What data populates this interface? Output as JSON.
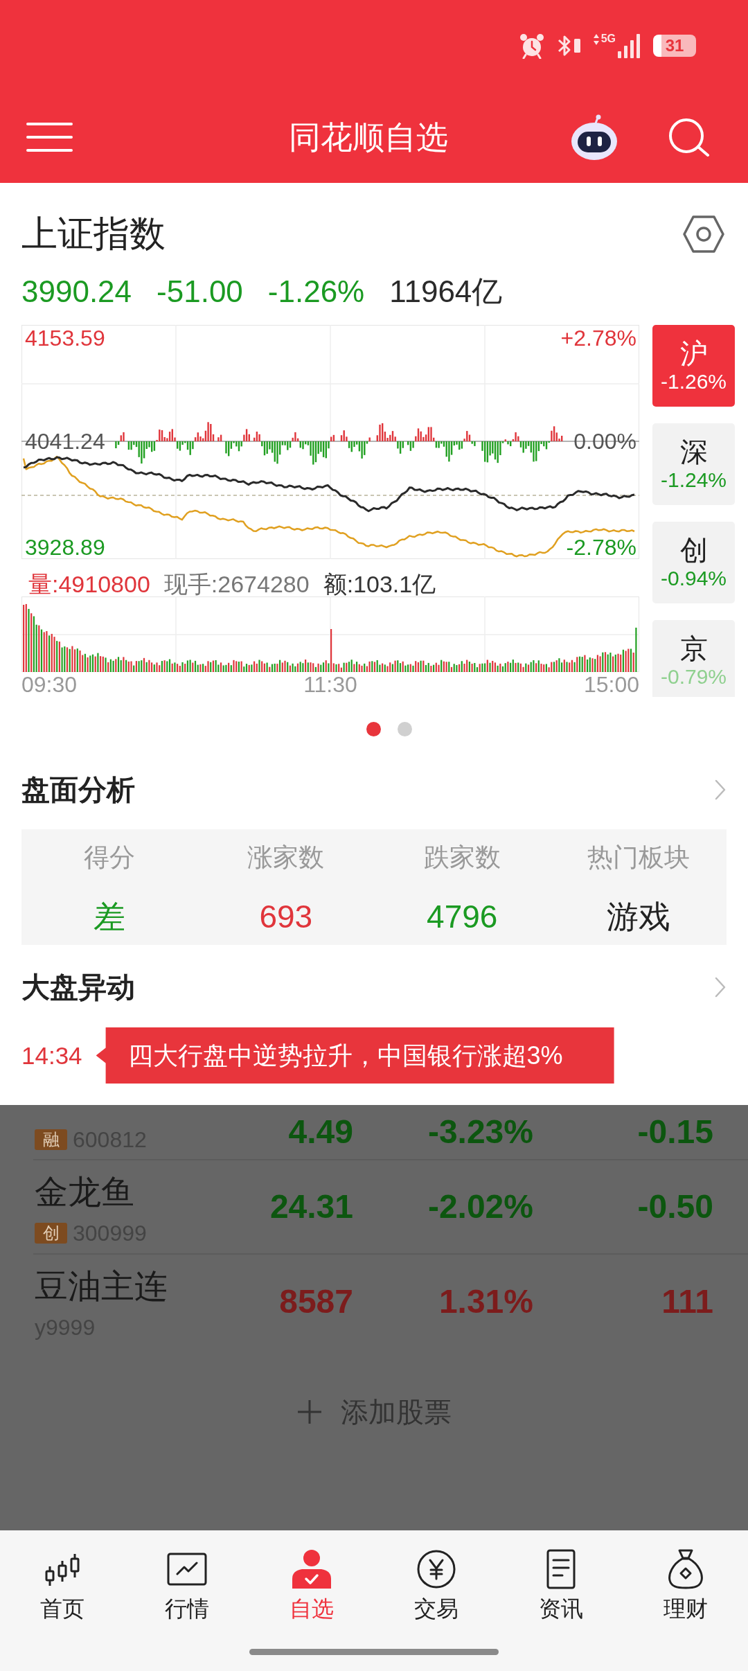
{
  "status_bar": {
    "network": "5G",
    "battery": "31"
  },
  "header": {
    "title": "同花顺自选"
  },
  "index": {
    "name": "上证指数",
    "price": "3990.24",
    "change": "-51.00",
    "percent": "-1.26%",
    "color": "#1b9a22",
    "turnover": "11964亿"
  },
  "chart": {
    "high": "4153.59",
    "high_percent": "+2.78%",
    "base": "4041.24",
    "base_percent": "0.00%",
    "low": "3928.89",
    "low_percent": "-2.78%",
    "volume": "量:4910800",
    "current_hand": "现手:2674280",
    "amount": "额:103.1亿",
    "times": [
      "09:30",
      "11:30",
      "15:00"
    ]
  },
  "market_tabs": [
    {
      "label": "沪",
      "percent": "-1.26%",
      "color": "#ffffff",
      "selected": true
    },
    {
      "label": "深",
      "percent": "-1.24%",
      "color": "#1b9a22",
      "selected": false
    },
    {
      "label": "创",
      "percent": "-0.94%",
      "color": "#1b9a22",
      "selected": false
    },
    {
      "label": "京",
      "percent": "-0.79%",
      "color": "#8fd08f",
      "selected": false
    }
  ],
  "pager": [
    {
      "selected": true
    },
    {
      "selected": false
    }
  ],
  "market_analysis": {
    "title": "盘面分析",
    "stats": [
      {
        "label": "得分",
        "value": "差",
        "color": "#1b9a22"
      },
      {
        "label": "涨家数",
        "value": "693",
        "color": "#e0353b"
      },
      {
        "label": "跌家数",
        "value": "4796",
        "color": "#1b9a22"
      },
      {
        "label": "热门板块",
        "value": "游戏",
        "color": "#222222"
      }
    ]
  },
  "market_moves": {
    "title": "大盘异动",
    "events": [
      {
        "time": "14:34",
        "text": "四大行盘中逆势拉升，中国银行涨超3%"
      }
    ]
  },
  "watchlist": [
    {
      "badge": "融",
      "code": "600812",
      "price": "4.49",
      "percent": "-3.23%",
      "change": "-0.15",
      "color": "#0c560f"
    },
    {
      "name": "金龙鱼",
      "badge": "创",
      "code": "300999",
      "price": "24.31",
      "percent": "-2.02%",
      "change": "-0.50",
      "color": "#0c560f"
    },
    {
      "name": "豆油主连",
      "code": "y9999",
      "price": "8587",
      "percent": "1.31%",
      "change": "111",
      "color": "#7c1c1c"
    }
  ],
  "add_stock": {
    "label": "添加股票"
  },
  "bottom_nav": [
    {
      "label": "首页",
      "selected": false
    },
    {
      "label": "行情",
      "selected": false
    },
    {
      "label": "自选",
      "selected": true
    },
    {
      "label": "交易",
      "selected": false
    },
    {
      "label": "资讯",
      "selected": false
    },
    {
      "label": "理财",
      "selected": false
    }
  ]
}
